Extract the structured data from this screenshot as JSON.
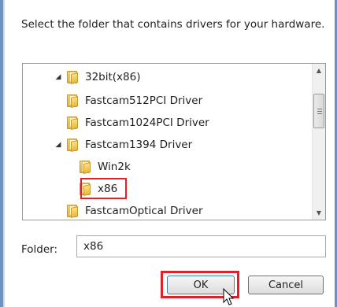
{
  "dialog": {
    "instruction": "Select the folder that contains drivers for your hardware."
  },
  "tree": {
    "items": [
      {
        "label": "32bit(x86)",
        "expander": "◢",
        "icon": "folder-icon"
      },
      {
        "label": "Fastcam512PCI Driver",
        "expander": "",
        "icon": "folder-icon"
      },
      {
        "label": "Fastcam1024PCI Driver",
        "expander": "",
        "icon": "folder-icon"
      },
      {
        "label": "Fastcam1394 Driver",
        "expander": "◢",
        "icon": "folder-icon"
      },
      {
        "label": "Win2k",
        "expander": "",
        "icon": "folder-icon"
      },
      {
        "label": "x86",
        "expander": "",
        "icon": "folder-icon",
        "selected": true
      },
      {
        "label": "FastcamOptical Driver",
        "expander": "",
        "icon": "folder-icon"
      }
    ],
    "scroll_up": "▲",
    "scroll_down": "▼"
  },
  "folder_field": {
    "label": "Folder:",
    "value": "x86"
  },
  "buttons": {
    "ok": "OK",
    "cancel": "Cancel"
  },
  "colors": {
    "highlight": "#e0202a",
    "frame": "#6e93c2"
  }
}
